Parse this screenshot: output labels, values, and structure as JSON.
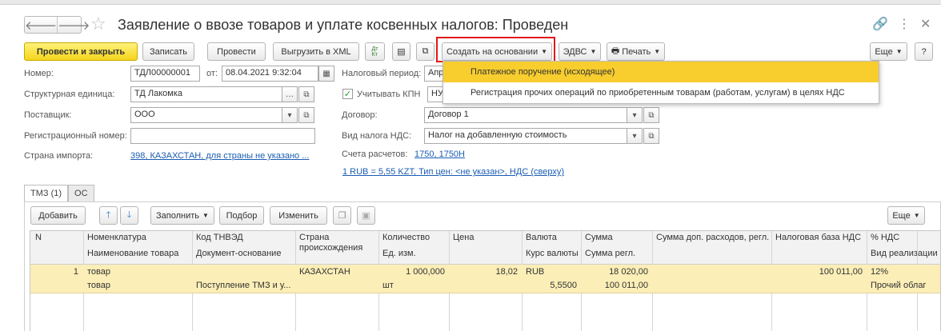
{
  "window": {
    "title": "Заявление о ввозе товаров и уплате косвенных налогов: Проведен"
  },
  "nav": {
    "back": "🡐",
    "forward": "🡒"
  },
  "toolbar": {
    "post_close": "Провести и закрыть",
    "save": "Записать",
    "post": "Провести",
    "export_xml": "Выгрузить в XML",
    "dtkt": "Дт Кт",
    "create_based": "Создать на основании",
    "edvs": "ЭДВС",
    "print": "Печать",
    "more": "Еще"
  },
  "dropdown": {
    "items": [
      "Платежное поручение (исходящее)",
      "Регистрация прочих операций по приобретенным товарам (работам, услугам) в целях НДС"
    ]
  },
  "form": {
    "number_label": "Номер:",
    "number_value": "ТДЛ00000001",
    "from_label": "от:",
    "date_value": "08.04.2021  9:32:04",
    "unit_label": "Структурная единица:",
    "unit_value": "ТД Лакомка",
    "supplier_label": "Поставщик:",
    "supplier_value": "ООО",
    "reg_label": "Регистрационный номер:",
    "reg_value": "",
    "country_label": "Страна импорта:",
    "country_value": "398, КАЗАХСТАН, для страны не указано ...",
    "period_label": "Налоговый период:",
    "period_value": "Апр",
    "kpn_label": "Учитывать КПН",
    "kpn_value": "НУ",
    "contract_label": "Договор:",
    "contract_value": "Договор 1",
    "vat_type_label": "Вид налога НДС:",
    "vat_type_value": "Налог на добавленную стоимость",
    "accounts_label": "Счета расчетов:",
    "accounts_value": "1750, 1750Н",
    "rate_link": "1 RUB = 5,55 KZT, Тип цен: <не указан>, НДС (сверху)"
  },
  "tabs": [
    "ТМЗ (1)",
    "ОС"
  ],
  "table_toolbar": {
    "add": "Добавить",
    "fill": "Заполнить",
    "select": "Подбор",
    "edit": "Изменить",
    "more": "Еще"
  },
  "table": {
    "headers": [
      [
        "N",
        ""
      ],
      [
        "Номенклатура",
        "Наименование товара"
      ],
      [
        "Код ТНВЭД",
        "Документ-основание"
      ],
      [
        "Страна происхождения",
        ""
      ],
      [
        "Количество",
        "Ед. изм."
      ],
      [
        "Цена",
        ""
      ],
      [
        "Валюта",
        "Курс валюты"
      ],
      [
        "Сумма",
        "Сумма регл."
      ],
      [
        "Сумма доп. расходов, регл.",
        ""
      ],
      [
        "Налоговая база НДС",
        ""
      ],
      [
        "% НДС",
        "Вид реализации"
      ]
    ],
    "row": {
      "n": "1",
      "nomen": "товар",
      "name": "товар",
      "tnved": "",
      "doc": "Поступление ТМЗ и у...",
      "country": "КАЗАХСТАН",
      "qty": "1 000,000",
      "unit": "шт",
      "price": "18,02",
      "currency": "RUB",
      "rate": "5,5500",
      "sum": "18 020,00",
      "sum_regl": "100 011,00",
      "extra": "",
      "vat_base": "100 011,00",
      "vat_pct": "12%",
      "sale_type": "Прочий облаг"
    }
  },
  "colors": {
    "accent_yellow": "#f5d51c",
    "highlight_red": "#e3171a",
    "link_blue": "#1b5db3",
    "row_select": "#fbeeb7"
  }
}
